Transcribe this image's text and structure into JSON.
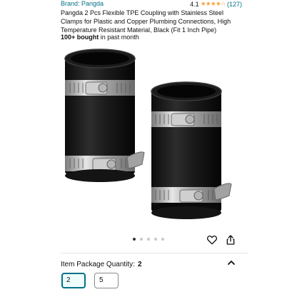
{
  "product": {
    "brand_label": "Brand: Pangda",
    "rating_value": "4.1",
    "stars": "★★★★☆",
    "review_count": "(127)",
    "title": "Pangda 2 Pcs Flexible TPE Coupling with Stainless Steel Clamps for Plastic and Copper Plumbing Connections, High Temperature Resistant Material, Black (Fit 1 Inch Pipe)",
    "bought_bold": "100+ bought",
    "bought_rest": " in past month"
  },
  "carousel": {
    "dot_count": 5,
    "active_index": 0
  },
  "icons": {
    "wishlist": "heart-icon",
    "share": "share-icon",
    "collapse": "chevron-up-icon"
  },
  "quantity": {
    "label": "Item Package Quantity:",
    "selected_value": "2",
    "options": [
      {
        "label": "2",
        "selected": true
      },
      {
        "label": "5",
        "selected": false
      }
    ]
  },
  "colors": {
    "link": "#007185",
    "star": "#f3a847",
    "selected_border": "#007185"
  }
}
